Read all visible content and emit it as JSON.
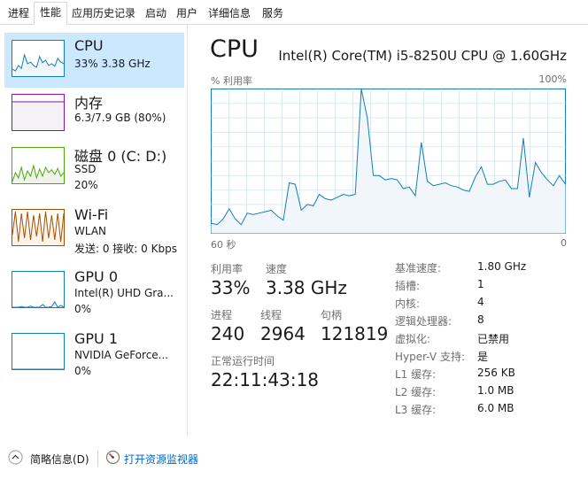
{
  "tabs": [
    "进程",
    "性能",
    "应用历史记录",
    "启动",
    "用户",
    "详细信息",
    "服务"
  ],
  "sidebar": {
    "cpu": {
      "title": "CPU",
      "sub1": "33% 3.38 GHz"
    },
    "mem": {
      "title": "内存",
      "sub1": "6.3/7.9 GB (80%)"
    },
    "disk": {
      "title": "磁盘 0 (C: D:)",
      "sub1": "SSD",
      "sub2": "20%"
    },
    "wifi": {
      "title": "Wi-Fi",
      "sub1": "WLAN",
      "sub2": "发送: 0 接收: 0 Kbps"
    },
    "gpu0": {
      "title": "GPU 0",
      "sub1": "Intel(R) UHD Gra...",
      "sub2": "0%"
    },
    "gpu1": {
      "title": "GPU 1",
      "sub1": "NVIDIA GeForce...",
      "sub2": "0%"
    }
  },
  "main": {
    "title": "CPU",
    "model": "Intel(R) Core(TM) i5-8250U CPU @ 1.60GHz",
    "graph_label_top_left": "% 利用率",
    "graph_label_top_right": "100%",
    "graph_label_bottom_left": "60 秒",
    "graph_label_bottom_right": "0"
  },
  "stats": {
    "utilization_label": "利用率",
    "utilization_value": "33%",
    "speed_label": "速度",
    "speed_value": "3.38 GHz",
    "processes_label": "进程",
    "processes_value": "240",
    "threads_label": "线程",
    "threads_value": "2964",
    "handles_label": "句柄",
    "handles_value": "121819",
    "uptime_label": "正常运行时间",
    "uptime_value": "22:11:43:18"
  },
  "details": [
    {
      "label": "基准速度:",
      "value": "1.80 GHz"
    },
    {
      "label": "插槽:",
      "value": "1"
    },
    {
      "label": "内核:",
      "value": "4"
    },
    {
      "label": "逻辑处理器:",
      "value": "8"
    },
    {
      "label": "虚拟化:",
      "value": "已禁用"
    },
    {
      "label": "Hyper-V 支持:",
      "value": "是"
    },
    {
      "label": "L1 缓存:",
      "value": "256 KB"
    },
    {
      "label": "L2 缓存:",
      "value": "1.0 MB"
    },
    {
      "label": "L3 缓存:",
      "value": "6.0 MB"
    }
  ],
  "footer": {
    "brief_label": "简略信息(D)",
    "monitor_label": "打开资源监视器"
  },
  "chart_data": {
    "type": "area",
    "xlabel": "60 秒",
    "ylabel": "% 利用率",
    "ylim": [
      0,
      100
    ],
    "x_label_left": "60 秒",
    "x_label_right": "0",
    "values": [
      7,
      6,
      10,
      17,
      10,
      6,
      14,
      13,
      14,
      15,
      16,
      12,
      9,
      35,
      34,
      16,
      20,
      19,
      27,
      24,
      23,
      25,
      27,
      26,
      27,
      100,
      80,
      40,
      40,
      37,
      38,
      37,
      31,
      32,
      26,
      63,
      36,
      33,
      34,
      35,
      33,
      32,
      30,
      29,
      39,
      46,
      34,
      34,
      36,
      37,
      31,
      31,
      66,
      25,
      49,
      42,
      37,
      33,
      40,
      34
    ],
    "colors": {
      "line": "#117dbb",
      "fill": "#f1f6fa",
      "grid": "#d9eaf4",
      "border": "#117dbb"
    }
  },
  "thumb_colors": {
    "cpu": "#117dbb",
    "mem": "#8b12ae",
    "disk": "#4da60c",
    "wifi": "#a74f01",
    "gpu0": "#117dbb",
    "gpu1": "#117dbb"
  }
}
